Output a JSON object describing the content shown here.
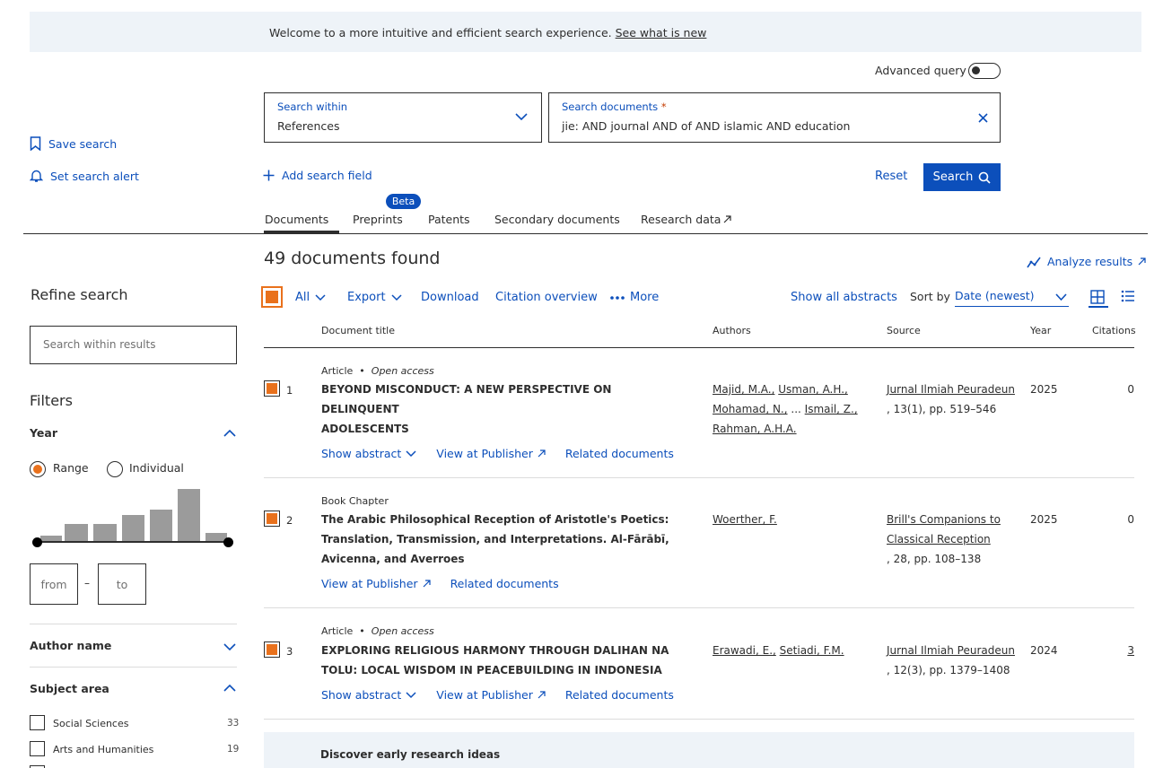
{
  "banner": {
    "text": "Welcome to a more intuitive and efficient search experience.",
    "link": "See what is new"
  },
  "advanced_query": {
    "label": "Advanced query",
    "enabled": false
  },
  "search_within": {
    "label": "Search within",
    "value": "References"
  },
  "search_documents": {
    "label": "Search documents",
    "required_mark": "*",
    "value": "jie: AND journal AND of AND islamic AND education"
  },
  "sidebar_actions": {
    "save_search": "Save search",
    "set_alert": "Set search alert"
  },
  "add_field": "Add search field",
  "reset": "Reset",
  "search_button": "Search",
  "tabs": [
    {
      "label": "Documents",
      "active": true
    },
    {
      "label": "Preprints",
      "badge": "Beta"
    },
    {
      "label": "Patents"
    },
    {
      "label": "Secondary documents"
    },
    {
      "label": "Research data"
    }
  ],
  "refine": {
    "title": "Refine search",
    "search_placeholder": "Search within results",
    "filters_title": "Filters",
    "year": {
      "label": "Year",
      "range_label": "Range",
      "individual_label": "Individual",
      "mode": "Range",
      "histogram": [
        0.1,
        0.32,
        0.32,
        0.5,
        0.6,
        1.0,
        0.15
      ],
      "from_placeholder": "from",
      "to_placeholder": "to",
      "dash": "–"
    },
    "author_name": "Author name",
    "subject_area": {
      "label": "Subject area",
      "items": [
        {
          "label": "Social Sciences",
          "count": "33"
        },
        {
          "label": "Arts and Humanities",
          "count": "19"
        }
      ]
    }
  },
  "results": {
    "count_text": "49 documents found",
    "analyze": "Analyze results",
    "toolbar": {
      "all": "All",
      "export": "Export",
      "download": "Download",
      "citation_overview": "Citation overview",
      "more": "More",
      "show_all_abstracts": "Show all abstracts",
      "sort_by": "Sort by",
      "sort_value": "Date (newest)"
    },
    "columns": {
      "title": "Document title",
      "authors": "Authors",
      "source": "Source",
      "year": "Year",
      "citations": "Citations"
    },
    "rows": [
      {
        "num": "1",
        "type": "Article",
        "open_access": "Open access",
        "title_lines": [
          "BEYOND MISCONDUCT: A NEW PERSPECTIVE ON DELINQUENT",
          "ADOLESCENTS"
        ],
        "authors": [
          "Majid, M.A.,",
          "Usman, A.H.,",
          "Mohamad, N.,",
          "...",
          "Ismail, Z.,",
          "Rahman, A.H.A."
        ],
        "source_name": "Jurnal Ilmiah Peuradeun",
        "source_detail": ", 13(1), pp. 519–546",
        "year": "2025",
        "citations": "0",
        "actions": {
          "abstract": "Show abstract",
          "publisher": "View at Publisher",
          "related": "Related documents"
        }
      },
      {
        "num": "2",
        "type": "Book Chapter",
        "title_lines": [
          "The Arabic Philosophical Reception of Aristotle's Poetics:",
          "Translation, Transmission, and Interpretations. Al-Fārābī,",
          "Avicenna, and Averroes"
        ],
        "authors": [
          "Woerther, F."
        ],
        "source_name_lines": [
          "Brill's Companions to",
          "Classical Reception"
        ],
        "source_detail": ", 28, pp. 108–138",
        "year": "2025",
        "citations": "0",
        "actions": {
          "publisher": "View at Publisher",
          "related": "Related documents"
        }
      },
      {
        "num": "3",
        "type": "Article",
        "open_access": "Open access",
        "title_lines": [
          "EXPLORING RELIGIOUS HARMONY THROUGH DALIHAN NA",
          "TOLU: LOCAL WISDOM IN PEACEBUILDING IN INDONESIA"
        ],
        "authors": [
          "Erawadi, E.,",
          "Setiadi, F.M."
        ],
        "source_name": "Jurnal Ilmiah Peuradeun",
        "source_detail": ", 12(3), pp. 1379–1408",
        "year": "2024",
        "citations": "3",
        "actions": {
          "abstract": "Show abstract",
          "publisher": "View at Publisher",
          "related": "Related documents"
        }
      }
    ],
    "discover": "Discover early research ideas"
  },
  "colors": {
    "accent": "#0c4fbb",
    "checkbox": "#e9711c",
    "banner_bg": "#eef3f8"
  }
}
